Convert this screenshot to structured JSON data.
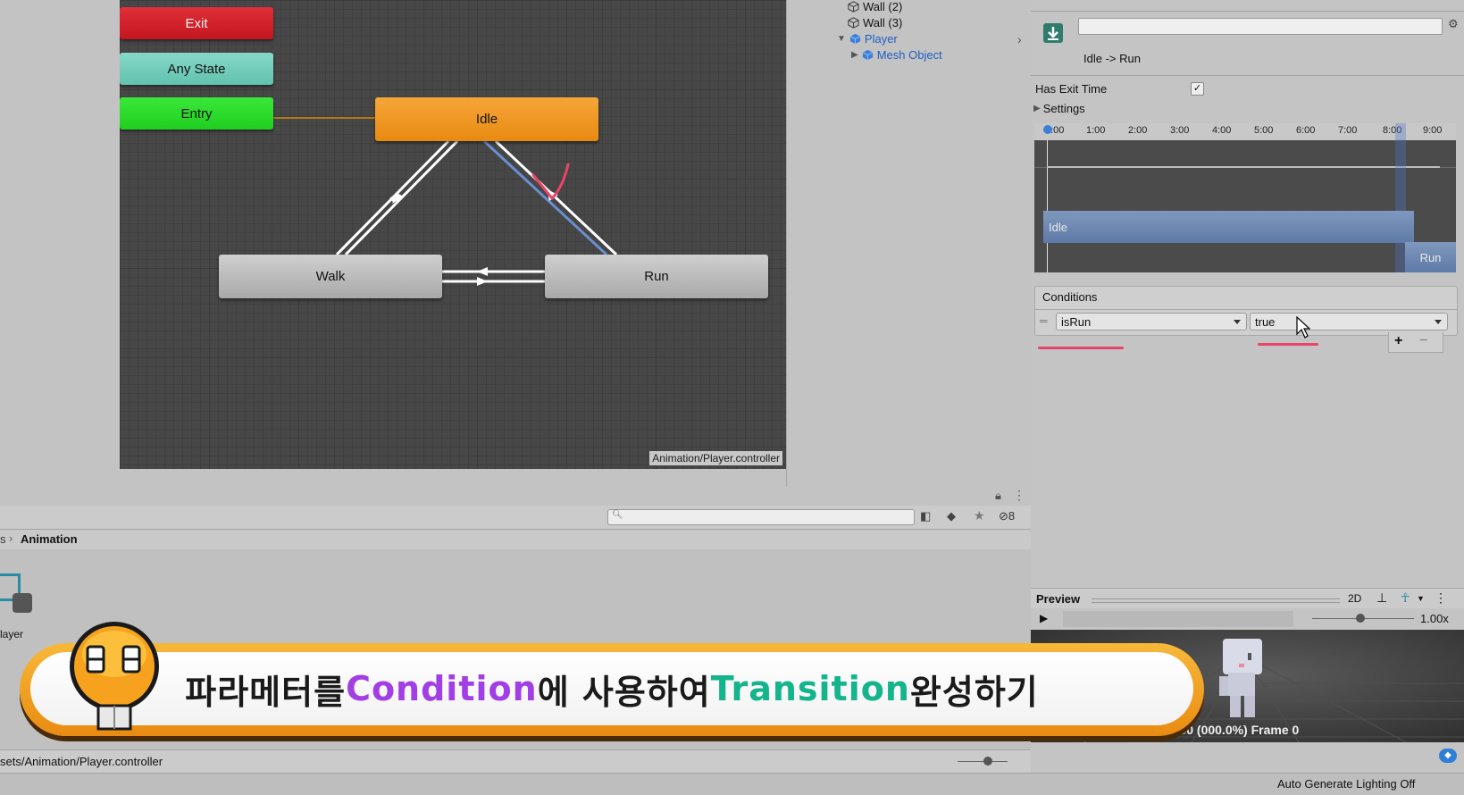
{
  "graph": {
    "nodes": {
      "exit": "Exit",
      "any_state": "Any State",
      "entry": "Entry",
      "idle": "Idle",
      "walk": "Walk",
      "run": "Run"
    },
    "path_label": "Animation/Player.controller"
  },
  "hierarchy": {
    "items": [
      {
        "label": "Wall (2)"
      },
      {
        "label": "Wall (3)"
      },
      {
        "label": "Player"
      },
      {
        "label": "Mesh Object"
      }
    ]
  },
  "inspector": {
    "transition_title": "Idle -> Run",
    "has_exit_time_label": "Has Exit Time",
    "has_exit_time_checked": true,
    "settings_label": "Settings",
    "timeline_ticks": [
      "0:00",
      "1:00",
      "2:00",
      "3:00",
      "4:00",
      "5:00",
      "6:00",
      "7:00",
      "8:00",
      "9:00"
    ],
    "idle_clip": "Idle",
    "run_clip": "Run",
    "conditions_label": "Conditions",
    "condition_param": "isRun",
    "condition_value": "true",
    "add_symbol": "+",
    "remove_symbol": "−",
    "preview_label": "Preview",
    "preview_2d": "2D",
    "speed": "1.00x",
    "frame_info": "0:00 (000.0%) Frame 0"
  },
  "project": {
    "hidden_count": "8",
    "breadcrumb_prev": "s",
    "breadcrumb_current": "Animation",
    "asset_label": "layer",
    "footer_path": "sets/Animation/Player.controller"
  },
  "status": {
    "lighting": "Auto Generate Lighting Off"
  },
  "banner": {
    "part1": "파라메터를 ",
    "part2": "Condition",
    "part3": "에 사용하여 ",
    "part4": "Transition",
    "part5": "완성하기"
  },
  "colors": {
    "accent_purple": "#a23ee6",
    "accent_teal": "#14b48c",
    "underline_red": "#e8446a"
  }
}
